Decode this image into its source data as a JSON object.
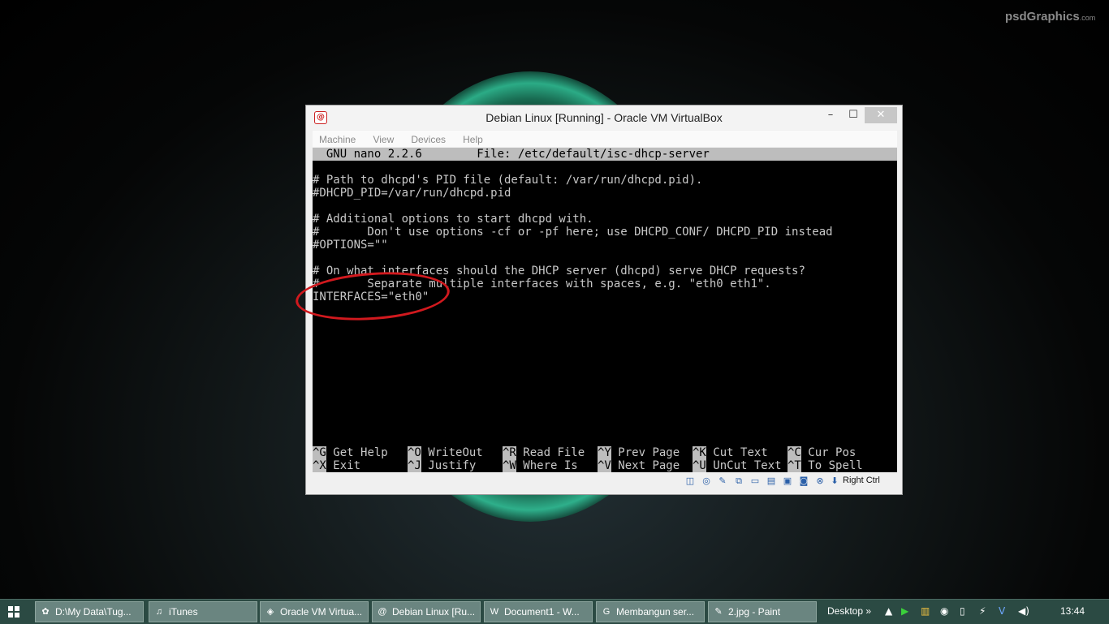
{
  "watermark": {
    "main": "psdGraphics",
    "suffix": ".com"
  },
  "window": {
    "title": "Debian Linux [Running] - Oracle VM VirtualBox",
    "min_glyph": "–",
    "max_glyph": "☐",
    "close_glyph": "✕",
    "menu": [
      "Machine",
      "View",
      "Devices",
      "Help"
    ],
    "host_key": "Right Ctrl"
  },
  "nano": {
    "header": "  GNU nano 2.2.6        File: /etc/default/isc-dhcp-server",
    "lines": [
      "",
      "# Path to dhcpd's PID file (default: /var/run/dhcpd.pid).",
      "#DHCPD_PID=/var/run/dhcpd.pid",
      "",
      "# Additional options to start dhcpd with.",
      "#       Don't use options -cf or -pf here; use DHCPD_CONF/ DHCPD_PID instead",
      "#OPTIONS=\"\"",
      "",
      "# On what interfaces should the DHCP server (dhcpd) serve DHCP requests?",
      "#       Separate multiple interfaces with spaces, e.g. \"eth0 eth1\".",
      "INTERFACES=\"eth0\""
    ],
    "shortcuts_row1": [
      {
        "key": "^G",
        "label": "Get Help"
      },
      {
        "key": "^O",
        "label": "WriteOut"
      },
      {
        "key": "^R",
        "label": "Read File"
      },
      {
        "key": "^Y",
        "label": "Prev Page"
      },
      {
        "key": "^K",
        "label": "Cut Text"
      },
      {
        "key": "^C",
        "label": "Cur Pos"
      }
    ],
    "shortcuts_row2": [
      {
        "key": "^X",
        "label": "Exit"
      },
      {
        "key": "^J",
        "label": "Justify"
      },
      {
        "key": "^W",
        "label": "Where Is"
      },
      {
        "key": "^V",
        "label": "Next Page"
      },
      {
        "key": "^U",
        "label": "UnCut Text"
      },
      {
        "key": "^T",
        "label": "To Spell"
      }
    ]
  },
  "taskbar": {
    "buttons": [
      {
        "label": "D:\\My Data\\Tug...",
        "icon": "folder-icon",
        "glyph": "✿"
      },
      {
        "label": "iTunes",
        "icon": "itunes-icon",
        "glyph": "♫"
      },
      {
        "label": "Oracle VM Virtua...",
        "icon": "virtualbox-icon",
        "glyph": "◈"
      },
      {
        "label": "Debian Linux [Ru...",
        "icon": "debian-icon",
        "glyph": "@"
      },
      {
        "label": "Document1 - W...",
        "icon": "word-icon",
        "glyph": "W"
      },
      {
        "label": "Membangun ser...",
        "icon": "chrome-icon",
        "glyph": "G"
      },
      {
        "label": "2.jpg - Paint",
        "icon": "paint-icon",
        "glyph": "✎"
      }
    ],
    "desktop_label": "Desktop",
    "chevron": "»",
    "clock": "13:44"
  },
  "colors": {
    "accent_red": "#d1191e",
    "taskbar": "#2b4a43"
  }
}
